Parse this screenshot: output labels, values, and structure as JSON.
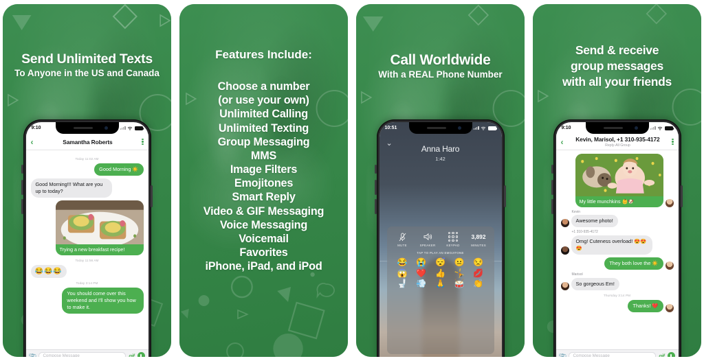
{
  "brand": {
    "green": "#3a8c4e",
    "bubble_green": "#4caf50",
    "accent": "#46a758"
  },
  "panels": [
    {
      "id": "panel-send-texts",
      "headline_main": "Send Unlimited Texts",
      "headline_sub": "To Anyone in the US and Canada",
      "phone": {
        "status_time": "9:10",
        "nav_title": "Samantha Roberts",
        "nav_sub": "",
        "messages": [
          {
            "type": "stamp",
            "text": "Today 11:02 AM"
          },
          {
            "type": "out",
            "text": "Good Morning ☀️"
          },
          {
            "type": "in",
            "text": "Good Morning!!! What are you up to today?"
          },
          {
            "type": "photo-out",
            "caption": "Trying a new breakfast recipe!"
          },
          {
            "type": "stamp",
            "text": "Today 11:56 AM"
          },
          {
            "type": "in-emoji",
            "text": "😂😂😂"
          },
          {
            "type": "stamp",
            "text": "Today 3:14 PM"
          },
          {
            "type": "out",
            "text": "You should come over this weekend and I'll show you how to make it."
          }
        ],
        "composer_placeholder": "Compose Message",
        "gif_label": "gif"
      }
    },
    {
      "id": "panel-features",
      "features_title": "Features Include:",
      "features": [
        "Choose a number",
        "(or use your own)",
        "Unlimited Calling",
        "Unlimited Texting",
        "Group Messaging",
        "MMS",
        "Image Filters",
        "Emojitones",
        "Smart Reply",
        "Video & GIF Messaging",
        "Voice Messaging",
        "Voicemail",
        "Favorites",
        "iPhone, iPad, and iPod"
      ]
    },
    {
      "id": "panel-call",
      "headline_main": "Call Worldwide",
      "headline_sub": "With a REAL Phone Number",
      "call": {
        "status_time": "10:51",
        "caller_name": "Anna Haro",
        "call_timer": "1:42",
        "controls": [
          {
            "label": "MUTE",
            "icon": "mic-muted-icon",
            "glyph": "🎙"
          },
          {
            "label": "SPEAKER",
            "icon": "speaker-icon",
            "glyph": "🔊"
          },
          {
            "label": "KEYPAD",
            "icon": "keypad-icon",
            "glyph": ""
          },
          {
            "label": "MINUTES",
            "icon": "minutes-counter",
            "glyph": "3,892"
          }
        ],
        "minutes_value": "3,892",
        "emoji_hint": "TAP TO PLAY AN EMOJITONE",
        "emojis": [
          "😂",
          "😭",
          "😴",
          "😐",
          "😒",
          "😱",
          "❤️",
          "👍",
          "🤸",
          "💋",
          "🚽",
          "💨",
          "🙏",
          "🥁",
          "👏"
        ]
      }
    },
    {
      "id": "panel-group",
      "headline_lines": [
        "Send & receive",
        "group messages",
        "with all your friends"
      ],
      "phone": {
        "status_time": "9:10",
        "nav_title": "Kevin, Marisol, +1 310-935-4172",
        "nav_sub": "Reply-All Group",
        "messages": [
          {
            "type": "photo-out",
            "caption": "My little munchkins 👶🐶"
          },
          {
            "type": "sender",
            "text": "Kevin"
          },
          {
            "type": "in",
            "text": "Awesome photo!"
          },
          {
            "type": "sender",
            "text": "+1 310-935-4172"
          },
          {
            "type": "in",
            "text": "Omg! Cuteness overload! 😍😍😍"
          },
          {
            "type": "out",
            "text": "They both love the ☀️"
          },
          {
            "type": "sender",
            "text": "Marisol"
          },
          {
            "type": "in",
            "text": "So gorgeous Em!"
          },
          {
            "type": "stamp",
            "text": "Thursday 3:14 PM"
          },
          {
            "type": "out",
            "text": "Thanks! ❤️"
          }
        ],
        "composer_placeholder": "Compose Message",
        "gif_label": "gif"
      }
    }
  ]
}
